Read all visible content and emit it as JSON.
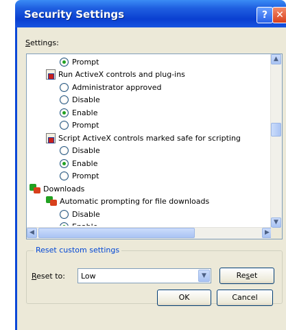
{
  "window": {
    "title": "Security Settings",
    "help_label": "?",
    "close_label": "✕"
  },
  "settings": {
    "label_underlined": "S",
    "label_rest": "ettings:",
    "items": [
      {
        "type": "radio",
        "label": "Prompt",
        "checked": true,
        "indent": 1
      },
      {
        "type": "category",
        "icon": "script-settings-icon",
        "label": "Run ActiveX controls and plug-ins",
        "indent": 0
      },
      {
        "type": "radio",
        "label": "Administrator approved",
        "checked": false,
        "indent": 1
      },
      {
        "type": "radio",
        "label": "Disable",
        "checked": false,
        "indent": 1
      },
      {
        "type": "radio",
        "label": "Enable",
        "checked": true,
        "indent": 1
      },
      {
        "type": "radio",
        "label": "Prompt",
        "checked": false,
        "indent": 1
      },
      {
        "type": "category",
        "icon": "script-settings-icon",
        "label": "Script ActiveX controls marked safe for scripting",
        "indent": 0
      },
      {
        "type": "radio",
        "label": "Disable",
        "checked": false,
        "indent": 1
      },
      {
        "type": "radio",
        "label": "Enable",
        "checked": true,
        "indent": 1
      },
      {
        "type": "radio",
        "label": "Prompt",
        "checked": false,
        "indent": 1
      },
      {
        "type": "group",
        "icon": "downloads-icon",
        "label": "Downloads",
        "indent": -1
      },
      {
        "type": "category",
        "icon": "downloads-icon",
        "label": "Automatic prompting for file downloads",
        "indent": 0
      },
      {
        "type": "radio",
        "label": "Disable",
        "checked": false,
        "indent": 1
      },
      {
        "type": "radio",
        "label": "Enable",
        "checked": true,
        "indent": 1
      }
    ]
  },
  "reset_group": {
    "title": "Reset custom settings",
    "reset_to_underlined": "R",
    "reset_to_rest": "eset to:",
    "selected_level": "Low",
    "reset_button_pre": "Re",
    "reset_button_underlined": "s",
    "reset_button_post": "et"
  },
  "buttons": {
    "ok": "OK",
    "cancel": "Cancel"
  }
}
